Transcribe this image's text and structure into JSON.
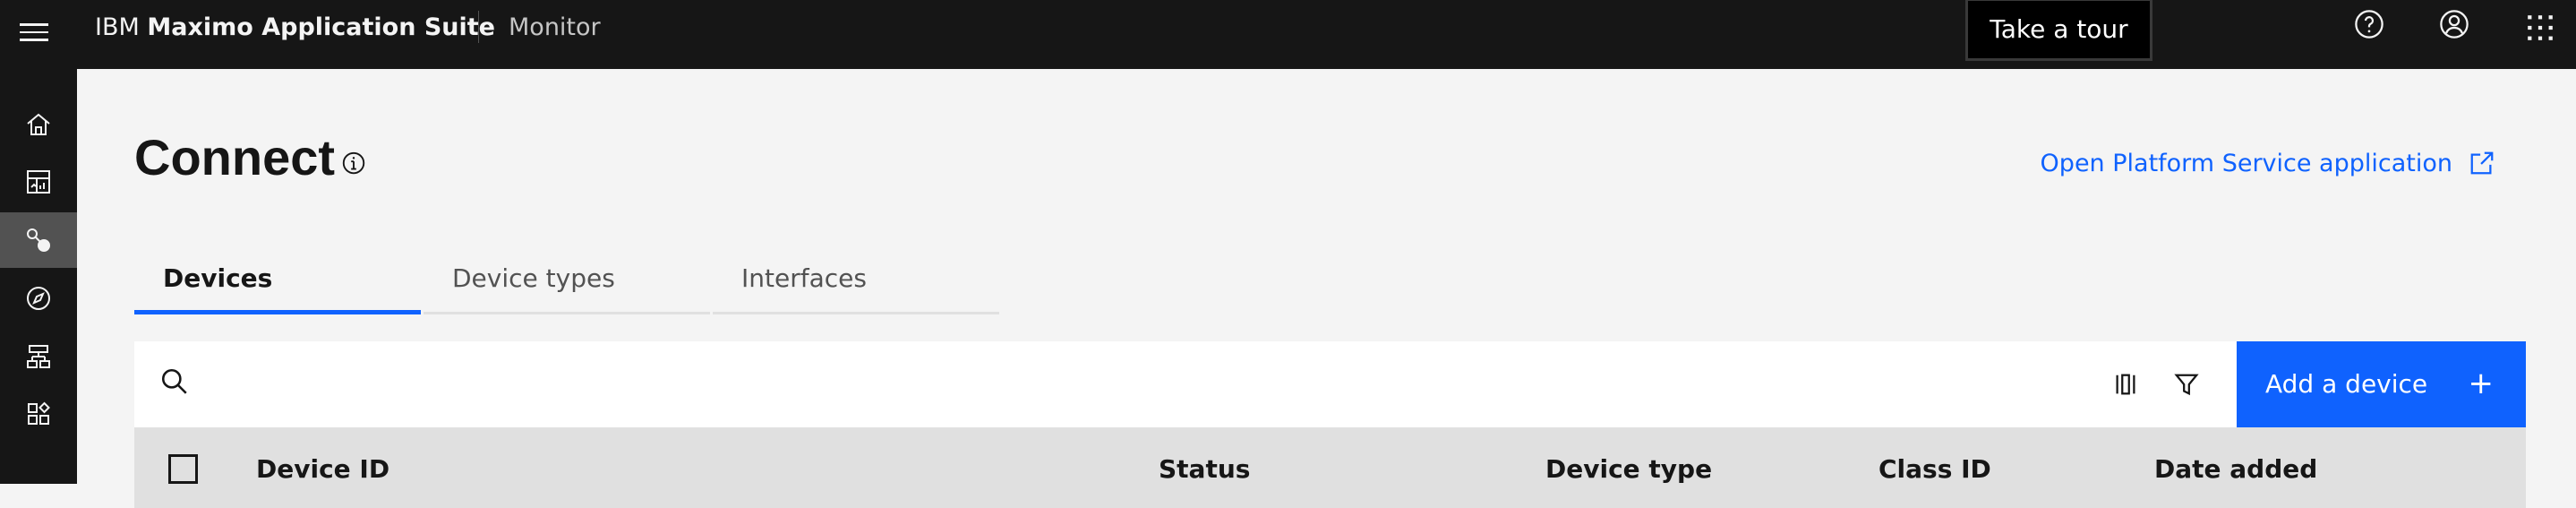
{
  "header": {
    "brand_prefix": "IBM",
    "brand_name": "Maximo Application Suite",
    "app_name": "Monitor",
    "tour_label": "Take a tour"
  },
  "sidebar": {
    "items": [
      {
        "icon": "home-icon"
      },
      {
        "icon": "dashboard-icon"
      },
      {
        "icon": "connect-icon",
        "active": true
      },
      {
        "icon": "compass-icon"
      },
      {
        "icon": "hierarchy-icon"
      },
      {
        "icon": "apps-icon"
      }
    ]
  },
  "page": {
    "title": "Connect",
    "platform_link": "Open Platform Service application"
  },
  "tabs": [
    {
      "label": "Devices",
      "active": true
    },
    {
      "label": "Device types",
      "active": false
    },
    {
      "label": "Interfaces",
      "active": false
    }
  ],
  "toolbar": {
    "search_placeholder": "",
    "add_label": "Add a device",
    "add_icon": "+"
  },
  "table": {
    "columns": [
      "Device ID",
      "Status",
      "Device type",
      "Class ID",
      "Date added"
    ]
  },
  "colors": {
    "accent": "#0f62fe",
    "topbar": "#161616",
    "background": "#f4f4f4"
  }
}
